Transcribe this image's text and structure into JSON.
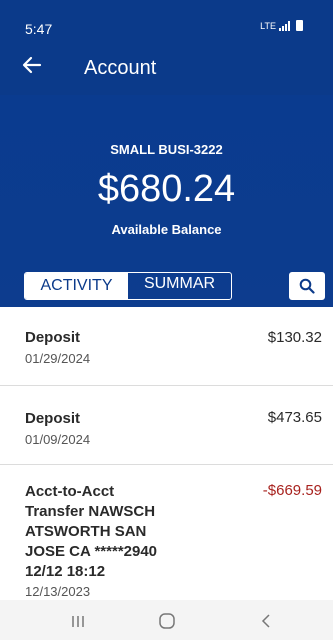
{
  "status_bar": {
    "time": "5:47",
    "network": "LTE"
  },
  "header": {
    "title": "Account"
  },
  "account": {
    "name": "SMALL BUSI-3222",
    "balance": "$680.24",
    "balance_label": "Available Balance"
  },
  "tabs": [
    {
      "label": "ACTIVITY",
      "active": true
    },
    {
      "label": "SUMMAR",
      "active": false
    }
  ],
  "transactions": [
    {
      "description": "Deposit",
      "date": "01/29/2024",
      "amount": "$130.32"
    },
    {
      "description": "Deposit",
      "date": "01/09/2024",
      "amount": "$473.65"
    },
    {
      "description_lines": [
        "Acct-to-Acct",
        "Transfer NAWSCH",
        "ATSWORTH SAN",
        "JOSE CA *****2940",
        "12/12 18:12"
      ],
      "date": "12/13/2023",
      "amount": "-$669.59"
    }
  ],
  "colors": {
    "brand": "#0b3a8a",
    "negative": "#a8231f"
  },
  "icons": [
    "back-arrow-icon",
    "search-icon",
    "recent-apps-icon",
    "home-icon",
    "back-icon"
  ]
}
